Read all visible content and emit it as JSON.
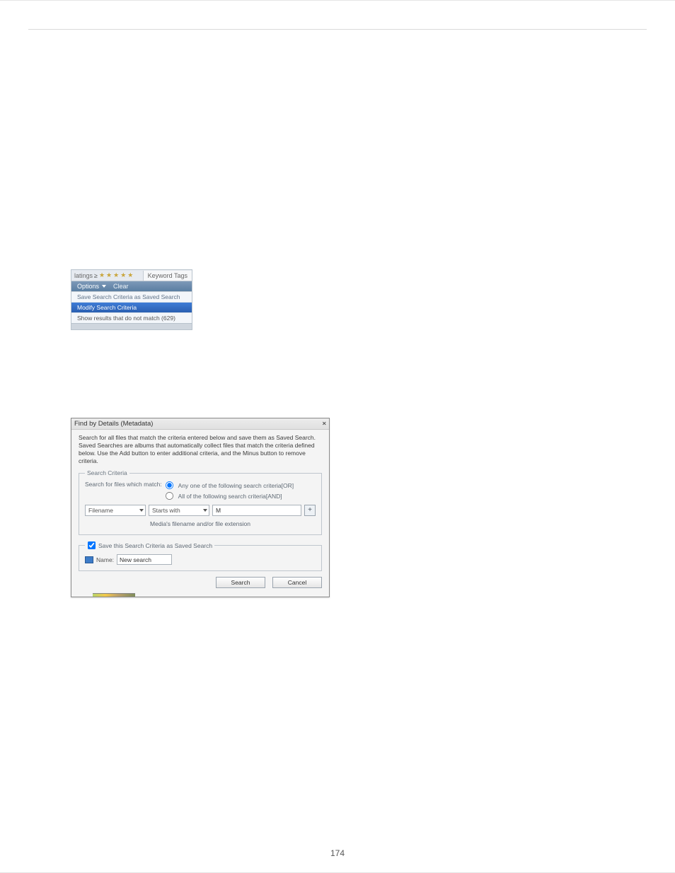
{
  "page_number": "174",
  "screenshot1": {
    "ratings_label": "latings",
    "rating_threshold": "≥",
    "keyword_tags_label": "Keyword Tags",
    "options_label": "Options",
    "clear_label": "Clear",
    "menu": {
      "save_search": "Save Search Criteria as Saved Search",
      "modify_search": "Modify Search Criteria",
      "show_no_match": "Show results that do not match (629)"
    }
  },
  "screenshot2": {
    "title": "Find by Details (Metadata)",
    "description": "Search for all files that match the criteria entered below and save them as Saved Search. Saved Searches are albums that automatically collect files that match the criteria defined below. Use the Add button to enter additional criteria, and the Minus button to remove criteria.",
    "search_criteria_legend": "Search Criteria",
    "match_label": "Search for files which match:",
    "radio_or": "Any one of the following search criteria[OR]",
    "radio_and": "All of the following search criteria[AND]",
    "criteria_row": {
      "field": "Filename",
      "operator": "Starts with",
      "value": "M",
      "add": "+"
    },
    "hint": "Media's filename and/or file extension",
    "save_legend": "Save this Search Criteria as Saved Search",
    "name_label": "Name:",
    "name_value": "New search",
    "search_btn": "Search",
    "cancel_btn": "Cancel"
  }
}
